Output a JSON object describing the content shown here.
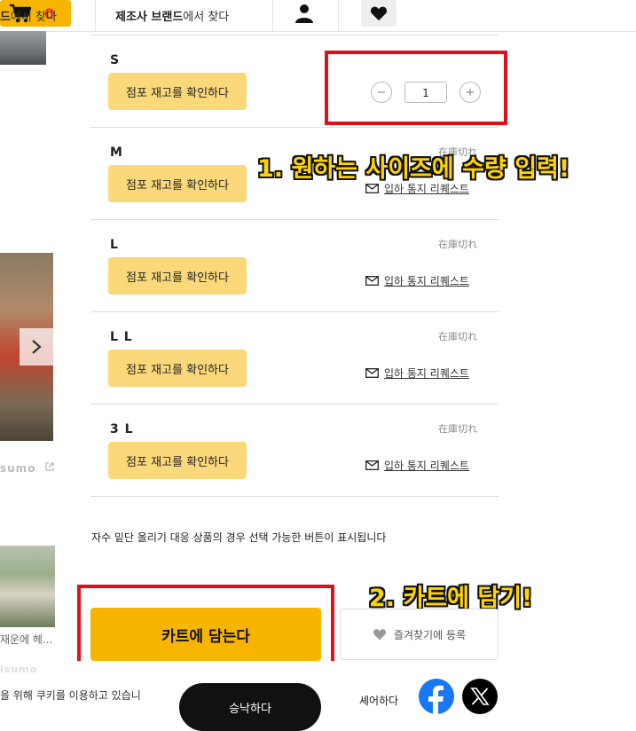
{
  "header": {
    "search_left_suffix": "에서 찾다",
    "search_left_prefix": "드",
    "brand_search_bold": "제조사 브랜드",
    "brand_search_suffix": "에서 찾다",
    "cart_count": "0"
  },
  "left_strip": {
    "brand_partial": "sumo",
    "caption_partial": "재운에 헤...",
    "faint_partial": "isumo"
  },
  "sizes": [
    {
      "label": "S",
      "stock_button": "점포 재고를 확인하다",
      "quantity": "1"
    },
    {
      "label": "M",
      "stock_button": "점포 재고를 확인하다",
      "status": "在庫切れ",
      "notify": "입하 통지 리퀘스트"
    },
    {
      "label": "L",
      "stock_button": "점포 재고를 확인하다",
      "status": "在庫切れ",
      "notify": "입하 통지 리퀘스트"
    },
    {
      "label": "L L",
      "stock_button": "점포 재고를 확인하다",
      "status": "在庫切れ",
      "notify": "입하 통지 리퀘스트"
    },
    {
      "label": "3 L",
      "stock_button": "점포 재고를 확인하다",
      "status": "在庫切れ",
      "notify": "입하 통지 리퀘스트"
    }
  ],
  "annotations": {
    "step1": "1. 원하는 사이즈에 수량 입력!",
    "step2": "2. 카트에 담기!"
  },
  "notice": "자수 밑단 올리기 대응 상품의 경우 선택 가능한 버튼이 표시됩니다",
  "actions": {
    "add_to_cart": "카트에 담는다",
    "favorite": "즐겨찾기에 등록"
  },
  "cookie": {
    "text": "을 위해 쿠키를 이용하고 있습니",
    "accept": "승낙하다"
  },
  "share": {
    "label": "셰어하다"
  },
  "colors": {
    "accent": "#f7b500",
    "stock_button": "#fbd97a",
    "annotation_box": "#e0101a",
    "annotation_text": "#ffd400",
    "cart_count": "#e23a2e"
  }
}
